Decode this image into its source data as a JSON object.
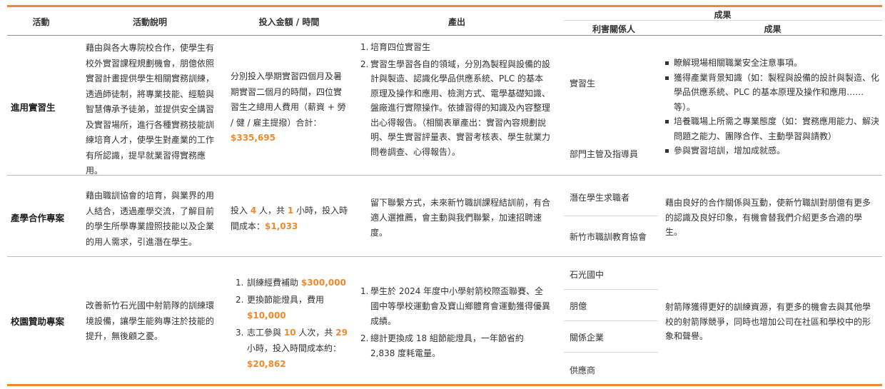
{
  "header": {
    "activity": "活動",
    "description": "活動說明",
    "investment": "投入金額 / 時間",
    "output": "產出",
    "outcome": "成果",
    "stakeholder": "利害關係人",
    "result": "成果"
  },
  "rows": [
    {
      "activity": "進用實習生",
      "description": "藉由與各大專院校合作，使學生有校外實習課程規劃機會，朋億依照實習計畫提供學生相關實務訓練，透過師徒制，將專業技能、經驗與智慧傳承予徒弟，並提供安全講習及實習場所，進行各種實務技能訓練培育人才，使學生對產業的工作有所認識，提早就業習得實務應用。",
      "investment_text": "分別投入學期實習四個月及暑期實習二個月的時間，四位實習生之總用人費用（薪資 + 勞 / 健 / 雇主提撥）合計：",
      "investment_amount": "$335,695",
      "outputs": [
        {
          "num": "1.",
          "text": "培育四位實習生"
        },
        {
          "num": "2.",
          "text": "實習生學習各自的領域，分別為製程與設備的設計與製造、認識化學品供應系統、PLC 的基本原理及操作和應用、檢測方式、電學基礎知識、盤廠進行實際操作。依據習得的知識及內容整理出心得報告。（相關表單產出：實習內容規劃說明、學生實習評量表、實習考核表、學生就業力問卷調查、心得報告）。"
        }
      ],
      "stakeholders": [
        "實習生",
        "部門主管及指導員"
      ],
      "results": [
        "瞭解現場相關職業安全注意事項。",
        "獲得產業背景知識（如：製程與設備的設計與製造、化學品供應系統、PLC 的基本原理及操作和應用……等）。",
        "培養職場上所需之專業態度（如：實務應用能力、解決問題之能力、團隊合作、主動學習與請教）",
        "參與實習培訓，增加成就感。"
      ]
    },
    {
      "activity": "產學合作專案",
      "description": "藉由職訓協會的培育，與業界的用人結合，透過產學交流，了解目前的學生所學專業證照技能以及企業的用人需求，引進潛在學生。",
      "inv_p1": "投入",
      "inv_n1": "4",
      "inv_p2": "人，共",
      "inv_n2": "1",
      "inv_p3": "小時，投入時間成本：",
      "inv_amount": "$1,033",
      "output": "留下聯繫方式，未來新竹職訓課程結訓前，有合適人選推薦，會主動與我們聯繫，加速招聘速度。",
      "stakeholders": [
        "潛在學生求職者",
        "新竹市職訓教育協會"
      ],
      "result": "藉由良好的合作關係與互動，使新竹職訓對朋億有更多的認識及良好印象，有機會替我們介紹更多合適的學生。"
    },
    {
      "activity": "校園贊助專案",
      "description": "改善新竹石光國中射箭隊的訓練環境設備，讓學生能夠專注於技能的提升，無後顧之憂。",
      "inv1_num": "1.",
      "inv1_text": "訓練經費補助",
      "inv1_amount": "$300,000",
      "inv2_num": "2.",
      "inv2_text": "更換節能燈具，費用",
      "inv2_amount": "$10,000",
      "inv3_num": "3.",
      "inv3_p1": "志工參與",
      "inv3_n1": "10",
      "inv3_p2": "人次，共",
      "inv3_n2": "29",
      "inv3_p3": "小時，投入時間成本約：",
      "inv3_amount": "$20,862",
      "outputs": [
        {
          "num": "1.",
          "text": "學生於 2024 年度中小學射箭校際盃聯賽、全國中等學校運動會及寶山鄉體育會運動獲得優異成績。"
        },
        {
          "num": "2.",
          "text": "總計更換成 18 組節能燈具，一年節省約 2,838 度耗電量。"
        }
      ],
      "stakeholders": [
        "石光國中",
        "朋億",
        "關係企業",
        "供應商"
      ],
      "result": "射箭隊獲得更好的訓練資源，有更多的機會去與其他學校的射箭隊競爭，同時也增加公司在社區和學校中的形象和聲譽。"
    }
  ],
  "colors": {
    "accent": "#ee8a2b",
    "text": "#333333",
    "rule": "#bdbdbd"
  }
}
